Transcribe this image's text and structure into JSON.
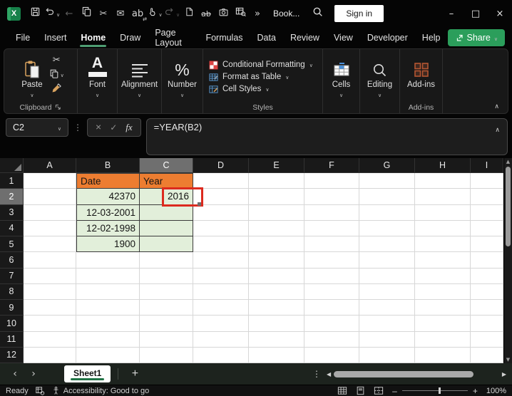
{
  "titlebar": {
    "document_title": "Book...",
    "sign_in_label": "Sign in",
    "qat_icons": [
      {
        "name": "save-icon",
        "type": "svg"
      },
      {
        "name": "undo-icon",
        "type": "svg",
        "chevron": true
      },
      {
        "name": "back-icon",
        "type": "text",
        "glyph": "←",
        "dim": true
      },
      {
        "name": "copy-icon",
        "type": "svg"
      },
      {
        "name": "cut-icon",
        "type": "text",
        "glyph": "✂"
      },
      {
        "name": "mail-icon",
        "type": "text",
        "glyph": "✉"
      },
      {
        "name": "find-replace-icon",
        "type": "text",
        "glyph": "ab",
        "sub": "⇄"
      },
      {
        "name": "touch-mode-icon",
        "type": "svg",
        "chevron": true
      },
      {
        "name": "redo-icon",
        "type": "svg",
        "dim": true,
        "chevron": true
      },
      {
        "name": "new-file-icon",
        "type": "svg"
      },
      {
        "name": "strikethrough-icon",
        "type": "text",
        "glyph": "ab",
        "strike": true
      },
      {
        "name": "camera-icon",
        "type": "svg"
      },
      {
        "name": "table-search-icon",
        "type": "svg"
      },
      {
        "name": "more-commands-icon",
        "type": "text",
        "glyph": "»"
      }
    ],
    "window_controls": {
      "minimize": "–",
      "maximize": "□",
      "close": "×"
    }
  },
  "menubar": {
    "items": [
      "File",
      "Insert",
      "Home",
      "Draw",
      "Page Layout",
      "Formulas",
      "Data",
      "Review",
      "View",
      "Developer",
      "Help"
    ],
    "active": "Home",
    "share_label": "Share"
  },
  "ribbon": {
    "paste_label": "Paste",
    "clipboard_group_label": "Clipboard",
    "font_label": "Font",
    "alignment_label": "Alignment",
    "number_label": "Number",
    "conditional_formatting_label": "Conditional Formatting",
    "format_as_table_label": "Format as Table",
    "cell_styles_label": "Cell Styles",
    "styles_group_label": "Styles",
    "cells_label": "Cells",
    "editing_label": "Editing",
    "addins_label": "Add-ins",
    "addins_group_label": "Add-ins"
  },
  "formula_bar": {
    "name_box_value": "C2",
    "fx_label": "fx",
    "formula": "=YEAR(B2)"
  },
  "grid": {
    "columns": [
      "A",
      "B",
      "C",
      "D",
      "E",
      "F",
      "G",
      "H",
      "I"
    ],
    "rows": [
      "1",
      "2",
      "3",
      "4",
      "5",
      "6",
      "7",
      "8",
      "9",
      "10",
      "11",
      "12"
    ],
    "selected_column": "C",
    "selected_row": "2",
    "cells": {
      "B1": "Date",
      "C1": "Year",
      "B2": "42370",
      "C2": "2016",
      "B3": "12-03-2001",
      "B4": "12-02-1998",
      "B5": "1900"
    },
    "colors": {
      "header_fill": "#ED7D31",
      "data_fill": "#E2EFDA",
      "highlight_box": "#DC2A1E",
      "selected_header": "#6F6F6F"
    }
  },
  "sheet_bar": {
    "active_tab": "Sheet1",
    "add_sheet_label": "+"
  },
  "status_bar": {
    "ready_label": "Ready",
    "accessibility_label": "Accessibility: Good to go",
    "zoom_percent": "100%"
  }
}
